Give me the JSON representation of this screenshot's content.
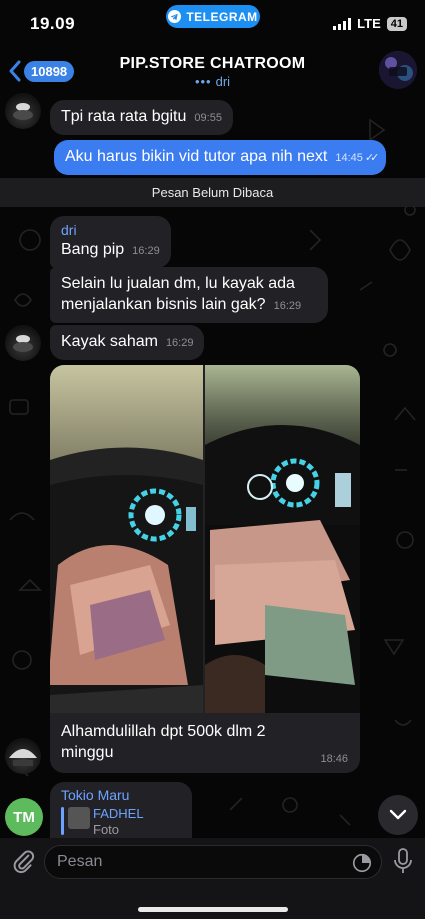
{
  "status_bar": {
    "time": "19.09",
    "app_pill": "TELEGRAM",
    "network": "LTE",
    "battery": "41"
  },
  "header": {
    "back_count": "10898",
    "title": "PIP.STORE CHATROOM",
    "subtitle_typing_user": "dri"
  },
  "messages": {
    "m1": {
      "text": "Tpi rata rata bgitu",
      "time": "09:55"
    },
    "m2": {
      "text": "Aku harus bikin vid tutor apa nih next",
      "time": "14:45"
    },
    "unread_label": "Pesan Belum Dibaca",
    "m3": {
      "sender": "dri",
      "text": "Bang pip",
      "time": "16:29"
    },
    "m4": {
      "text_line1": "Selain lu jualan dm, lu kayak ada",
      "text_line2": "menjalankan bisnis lain gak?",
      "time": "16:29"
    },
    "m5": {
      "text": "Kayak saham",
      "time": "16:29"
    },
    "m6": {
      "caption": "Alhamdulillah dpt 500k dlm 2 minggu",
      "time": "18:46"
    },
    "m7": {
      "sender": "Tokio Maru",
      "avatar_initials": "TM",
      "quoted_name": "FADHEL",
      "quoted_type": "Foto"
    }
  },
  "input": {
    "placeholder": "Pesan"
  },
  "icons": {
    "telegram": "telegram-plane-icon",
    "back": "chevron-left-icon",
    "attach": "paperclip-icon",
    "sticker": "sticker-clock-icon",
    "mic": "microphone-icon",
    "scroll": "chevron-down-icon"
  },
  "colors": {
    "outgoing_bubble": "#3b7cf0",
    "incoming_bubble": "#222226",
    "accent_blue": "#6ea2ff",
    "telegram_pill": "#1d8ff0",
    "tm_avatar": "#5dbb5d"
  }
}
